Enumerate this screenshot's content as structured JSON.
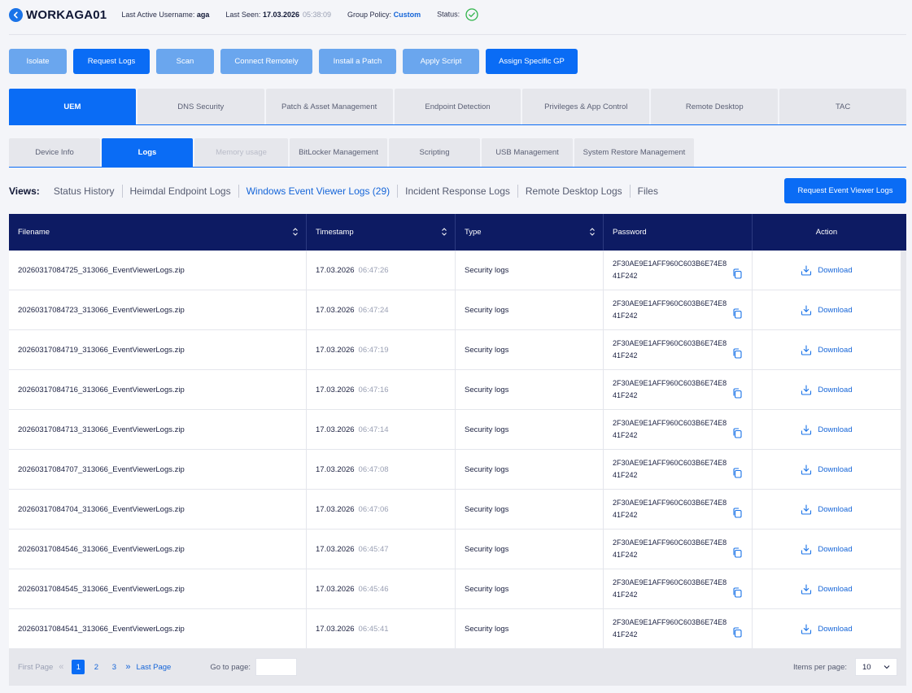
{
  "header": {
    "device_name": "WORKAGA01",
    "last_active_label": "Last Active Username:",
    "last_active_value": "aga",
    "last_seen_label": "Last Seen:",
    "last_seen_date": "17.03.2026",
    "last_seen_time": "05:38:09",
    "group_policy_label": "Group Policy:",
    "group_policy_value": "Custom",
    "status_label": "Status:",
    "status_icon": "check-circle-icon",
    "accent_color": "#0a6cf5"
  },
  "actions": [
    {
      "label": "Isolate",
      "style": "light"
    },
    {
      "label": "Request Logs",
      "style": "dark"
    },
    {
      "label": "Scan",
      "style": "light"
    },
    {
      "label": "Connect Remotely",
      "style": "light"
    },
    {
      "label": "Install a Patch",
      "style": "light"
    },
    {
      "label": "Apply Script",
      "style": "light"
    },
    {
      "label": "Assign Specific GP",
      "style": "dark"
    }
  ],
  "main_tabs": [
    "UEM",
    "DNS Security",
    "Patch & Asset Management",
    "Endpoint Detection",
    "Privileges & App Control",
    "Remote Desktop",
    "TAC"
  ],
  "sub_tabs": [
    "Device Info",
    "Logs",
    "Memory usage",
    "BitLocker Management",
    "Scripting",
    "USB Management",
    "System Restore Management"
  ],
  "views": {
    "label": "Views:",
    "items": [
      "Status History",
      "Heimdal Endpoint Logs",
      "Windows Event Viewer Logs (29)",
      "Incident Response Logs",
      "Remote Desktop Logs",
      "Files"
    ],
    "request_button": "Request Event Viewer Logs"
  },
  "table": {
    "columns": [
      "Filename",
      "Timestamp",
      "Type",
      "Password",
      "Action"
    ],
    "rows": [
      {
        "filename": "20260317084725_313066_EventViewerLogs.zip",
        "date": "17.03.2026",
        "time": "06:47:26",
        "type": "Security logs",
        "password": "2F30AE9E1AFF960C603B6E74E841F242",
        "action": "Download"
      },
      {
        "filename": "20260317084723_313066_EventViewerLogs.zip",
        "date": "17.03.2026",
        "time": "06:47:24",
        "type": "Security logs",
        "password": "2F30AE9E1AFF960C603B6E74E841F242",
        "action": "Download"
      },
      {
        "filename": "20260317084719_313066_EventViewerLogs.zip",
        "date": "17.03.2026",
        "time": "06:47:19",
        "type": "Security logs",
        "password": "2F30AE9E1AFF960C603B6E74E841F242",
        "action": "Download"
      },
      {
        "filename": "20260317084716_313066_EventViewerLogs.zip",
        "date": "17.03.2026",
        "time": "06:47:16",
        "type": "Security logs",
        "password": "2F30AE9E1AFF960C603B6E74E841F242",
        "action": "Download"
      },
      {
        "filename": "20260317084713_313066_EventViewerLogs.zip",
        "date": "17.03.2026",
        "time": "06:47:14",
        "type": "Security logs",
        "password": "2F30AE9E1AFF960C603B6E74E841F242",
        "action": "Download"
      },
      {
        "filename": "20260317084707_313066_EventViewerLogs.zip",
        "date": "17.03.2026",
        "time": "06:47:08",
        "type": "Security logs",
        "password": "2F30AE9E1AFF960C603B6E74E841F242",
        "action": "Download"
      },
      {
        "filename": "20260317084704_313066_EventViewerLogs.zip",
        "date": "17.03.2026",
        "time": "06:47:06",
        "type": "Security logs",
        "password": "2F30AE9E1AFF960C603B6E74E841F242",
        "action": "Download"
      },
      {
        "filename": "20260317084546_313066_EventViewerLogs.zip",
        "date": "17.03.2026",
        "time": "06:45:47",
        "type": "Security logs",
        "password": "2F30AE9E1AFF960C603B6E74E841F242",
        "action": "Download"
      },
      {
        "filename": "20260317084545_313066_EventViewerLogs.zip",
        "date": "17.03.2026",
        "time": "06:45:46",
        "type": "Security logs",
        "password": "2F30AE9E1AFF960C603B6E74E841F242",
        "action": "Download"
      },
      {
        "filename": "20260317084541_313066_EventViewerLogs.zip",
        "date": "17.03.2026",
        "time": "06:45:41",
        "type": "Security logs",
        "password": "2F30AE9E1AFF960C603B6E74E841F242",
        "action": "Download"
      }
    ]
  },
  "pagination": {
    "first": "First Page",
    "pages": [
      "1",
      "2",
      "3"
    ],
    "last": "Last Page",
    "goto_label": "Go to page:",
    "goto_value": "",
    "items_label": "Items per page:",
    "items_value": "10"
  }
}
